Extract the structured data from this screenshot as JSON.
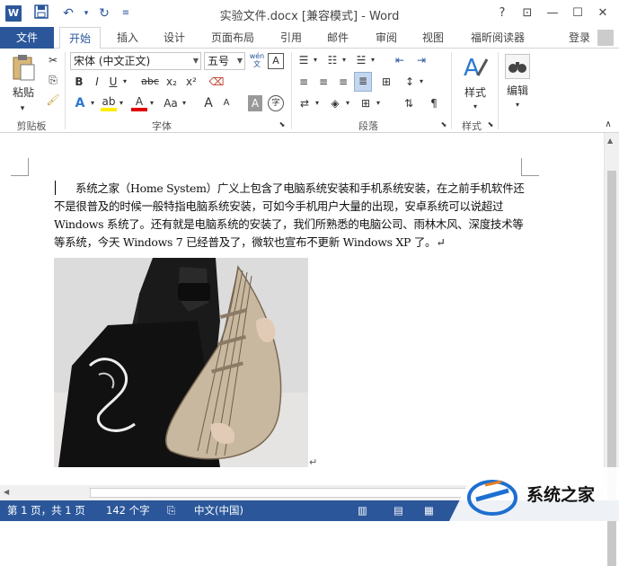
{
  "titlebar": {
    "app_icon": "W",
    "title": "实验文件.docx [兼容模式] - Word",
    "help": "?",
    "restore_ribbon": "⊡",
    "minimize": "—",
    "maximize": "☐",
    "close": "✕"
  },
  "tabs": {
    "file": "文件",
    "items": [
      "开始",
      "插入",
      "设计",
      "页面布局",
      "引用",
      "邮件",
      "审阅",
      "视图",
      "福昕阅读器"
    ],
    "login": "登录"
  },
  "ribbon": {
    "clipboard": {
      "paste": "粘贴",
      "label": "剪贴板"
    },
    "font": {
      "font_name": "宋体 (中文正文)",
      "font_size": "五号",
      "wen": "wén",
      "bold": "B",
      "italic": "I",
      "underline": "U",
      "strike": "abc",
      "sub": "x₂",
      "sup": "x²",
      "label": "字体"
    },
    "paragraph": {
      "label": "段落"
    },
    "styles": {
      "label": "样式",
      "button": "样式"
    },
    "editing": {
      "button": "编辑"
    }
  },
  "document": {
    "paragraph": "系统之家（Home System）广义上包含了电脑系统安装和手机系统安装，在之前手机软件还不是很普及的时候一般特指电脑系统安装，可如今手机用户大量的出现，安卓系统可以说超过 Windows 系统了。还有就是电脑系统的安装了，我们所熟悉的电脑公司、雨林木风、深度技术等等系统，今天 Windows 7 已经普及了，微软也宣布不更新 Windows XP 了。↵",
    "after_image_mark": "↵"
  },
  "statusbar": {
    "page": "第 1 页，共 1 页",
    "words": "142 个字",
    "language": "中文(中国)"
  },
  "watermark": {
    "text": "系统之家"
  },
  "colors": {
    "accent": "#2b579a"
  }
}
